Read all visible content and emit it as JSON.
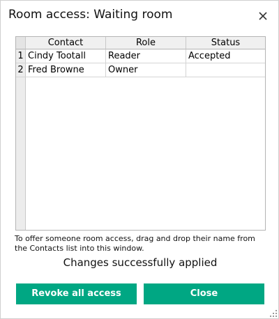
{
  "window": {
    "title": "Room access: Waiting room",
    "close_icon": "close-icon"
  },
  "table": {
    "columns": [
      "Contact",
      "Role",
      "Status"
    ],
    "rows": [
      {
        "num": "1",
        "contact": "Cindy Tootall",
        "role": "Reader",
        "status": "Accepted"
      },
      {
        "num": "2",
        "contact": "Fred Browne",
        "role": "Owner",
        "status": ""
      }
    ]
  },
  "hint_text": "To offer someone room access, drag and drop their name from the Contacts list into this window.",
  "status_message": "Changes successfully applied",
  "buttons": {
    "revoke_label": "Revoke all access",
    "close_label": "Close"
  },
  "colors": {
    "button_bg": "#00a783",
    "button_text": "#ffffff"
  }
}
